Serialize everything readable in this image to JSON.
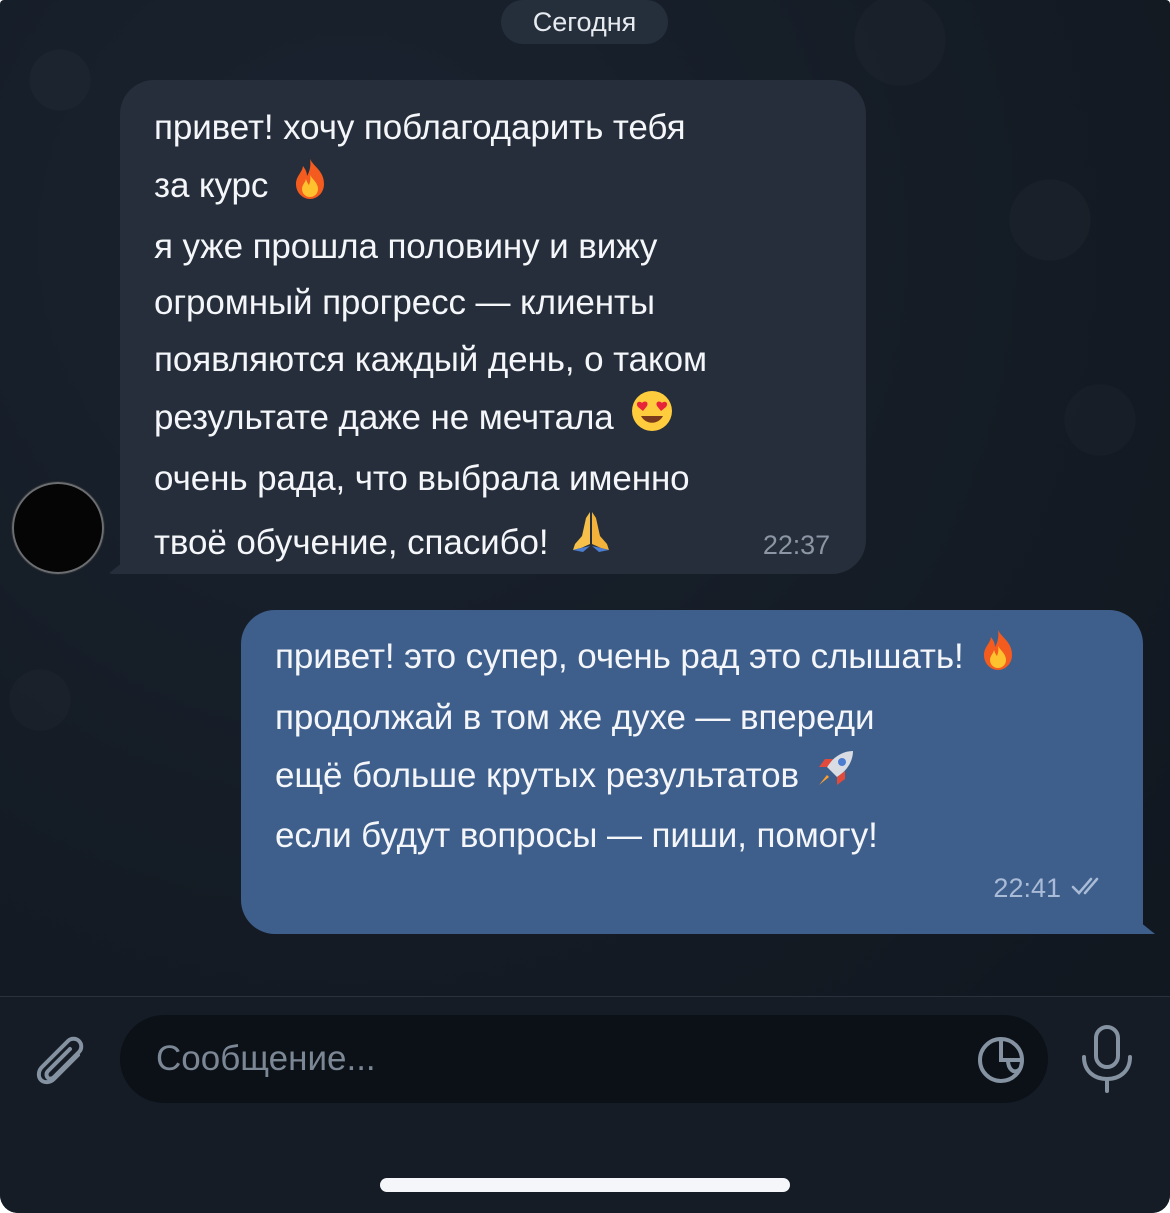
{
  "chat": {
    "date_label": "Сегодня",
    "incoming": {
      "lines": [
        "привет! хочу поблагодарить тебя",
        "за курс",
        "я уже прошла половину и вижу",
        "огромный прогресс — клиенты",
        "появляются каждый день, о таком",
        "результате даже не мечтала",
        "очень рада, что выбрала именно",
        "твоё обучение, спасибо!"
      ],
      "time": "22:37",
      "emojis": [
        "fire-emoji",
        "heart-eyes-emoji",
        "folded-hands-emoji"
      ]
    },
    "outgoing": {
      "lines": [
        "привет! это супер, очень рад это слышать!",
        "продолжай в том же духе — впереди",
        "ещё больше крутых результатов",
        "если будут вопросы — пиши, помогу!"
      ],
      "time": "22:41",
      "status_icon": "double-check-icon",
      "emojis": [
        "fire-emoji",
        "rocket-emoji"
      ]
    }
  },
  "composer": {
    "placeholder": "Сообщение...",
    "attach_icon": "paperclip-icon",
    "sticker_icon": "sticker-icon",
    "mic_icon": "microphone-icon"
  },
  "colors": {
    "background": "#141b24",
    "incoming_bubble": "#252e3a",
    "outgoing_bubble": "#3e5f8c",
    "input_field": "#0c1118"
  }
}
